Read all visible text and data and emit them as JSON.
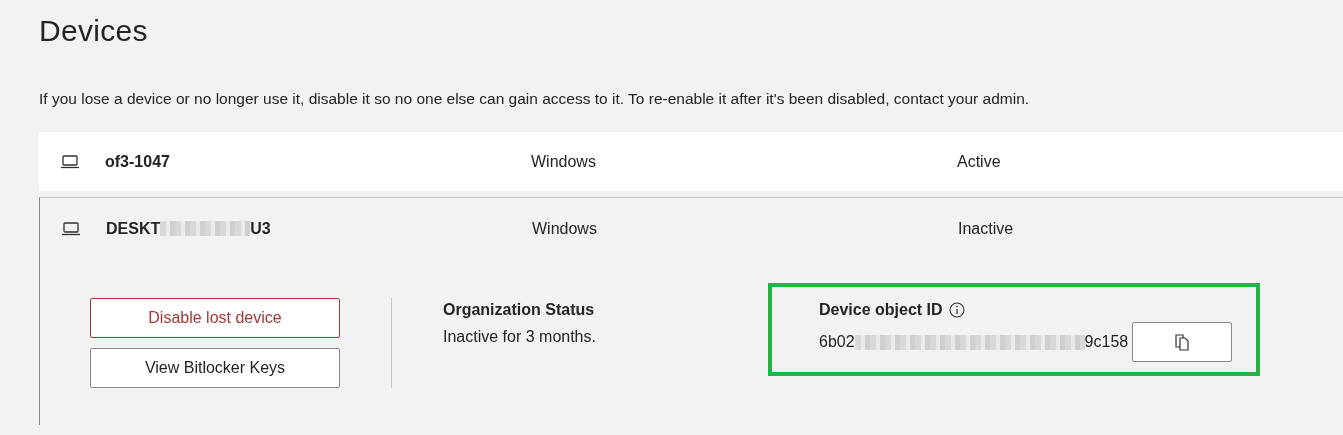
{
  "page": {
    "title": "Devices",
    "description": "If you lose a device or no longer use it, disable it so no one else can gain access to it. To re-enable it after it's been disabled, contact your admin."
  },
  "devices": [
    {
      "name": [
        {
          "kind": "text",
          "text": "of3-1047"
        }
      ],
      "os": "Windows",
      "status": "Active",
      "expanded": false
    },
    {
      "name": [
        {
          "kind": "text",
          "text": "DESKT"
        },
        {
          "kind": "redacted"
        },
        {
          "kind": "text",
          "text": "U3"
        }
      ],
      "os": "Windows",
      "status": "Inactive",
      "expanded": true,
      "details": {
        "buttons": [
          {
            "label": "Disable lost device",
            "kind": "danger"
          },
          {
            "label": "View Bitlocker Keys",
            "kind": "default"
          }
        ],
        "organization_status": {
          "heading": "Organization Status",
          "value": "Inactive for 3 months."
        },
        "device_object_id": {
          "heading": "Device object ID",
          "value": [
            {
              "kind": "text",
              "text": "6b02"
            },
            {
              "kind": "redacted"
            },
            {
              "kind": "text",
              "text": "9c158"
            }
          ],
          "highlighted": true
        }
      }
    }
  ]
}
